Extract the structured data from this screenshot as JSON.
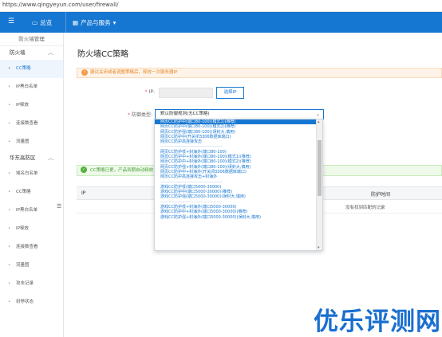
{
  "browser": {
    "url": "https://www.qingyeyun.com/user/firewall/"
  },
  "topnav": {
    "menu_icon": "menu-icon",
    "overview_label": "总览",
    "products_label": "产品与服务",
    "products_chevron": "▾"
  },
  "sidebar": {
    "header": "防火墙管理",
    "groups": [
      {
        "label": "防火墙",
        "items": [
          "CC策略",
          "IP黑白名单",
          "IP释放",
          "连接数查看",
          "流量图"
        ]
      },
      {
        "label": "华东高防区",
        "items": [
          "域名白名单",
          "CC策略",
          "IP黑白名单",
          "IP释放",
          "连接数查看",
          "流量图",
          "攻击记录",
          "封停状态"
        ]
      }
    ]
  },
  "main": {
    "title": "防火墙CC策略",
    "warning": "建议关闭或者调整策略后，释放一次服务器IP",
    "ip_label": "IP:",
    "select_ip_button": "选择IP",
    "defense_label": "防御类型:",
    "defense_selected": "默认防御规则(无CC策略)",
    "success_msg": "CC策略已更，产品到期自动释放",
    "table": {
      "columns": [
        "IP",
        "防护时间"
      ],
      "empty_text": "没有找到匹配的记录"
    }
  },
  "dropdown": {
    "options": [
      "网页CC防护中(端口80-100)(模式1)(推荐)",
      "网页CC防护中(端口80-100)(模式2)(推荐)",
      "网页CC防护强(端口80-100)(误封大,慎用)",
      "网页CC防护中(开关闭3306数据库端口)",
      "网页CC防护高连接攻击",
      "-------------------------------------------",
      "网页CC防护低+封海外(端口80-100)",
      "网页CC防护中+封海外(端口80-100)(模式1)(推荐)",
      "网页CC防护中+封海外(端口80-100)(模式2)(推荐)",
      "网页CC防护强+封海外(端口80-100)(误封大,慎用)",
      "网页CC防护中+封海外(开关闭3306数据库端口)",
      "网页CC防护高连接攻击+封海外",
      "-------------------------------------------",
      "游戏CC防护低(端口5000-30000)",
      "游戏CC防护中(端口5000-30000)(推荐)",
      "游戏CC防护强(端口5000-30000)(误封大,慎用)",
      "-------------------------------------------",
      "游戏CC防护低+封海外(端口5000-30000)",
      "游戏CC防护中+封海外(端口5000-30000)(推荐)",
      "游戏CC防护强+封海外(端口5000-30000)(误封大,慎用)"
    ]
  },
  "watermark": "优乐评测网",
  "colors": {
    "brand": "#1677d2",
    "warning": "#e48a2c",
    "success": "#4a9e35"
  }
}
